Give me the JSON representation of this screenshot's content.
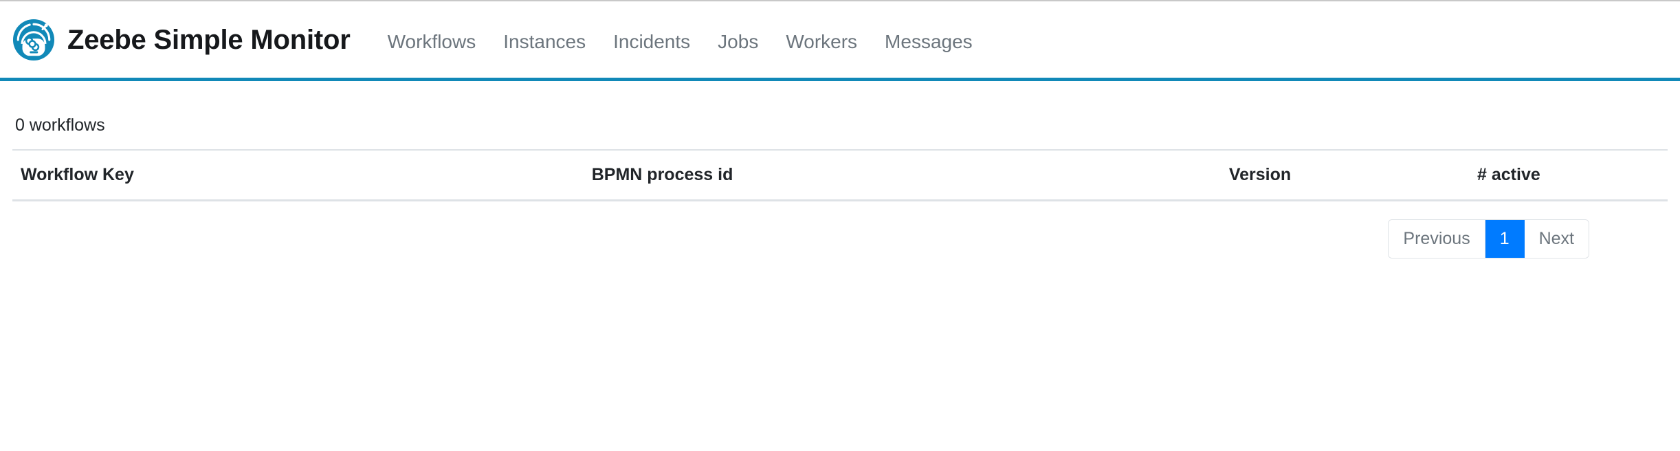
{
  "brand": {
    "title": "Zeebe Simple Monitor",
    "logo_icon": "zeebe-robot-logo",
    "accent_color": "#1189b8"
  },
  "nav": {
    "items": [
      {
        "label": "Workflows",
        "name": "workflows"
      },
      {
        "label": "Instances",
        "name": "instances"
      },
      {
        "label": "Incidents",
        "name": "incidents"
      },
      {
        "label": "Jobs",
        "name": "jobs"
      },
      {
        "label": "Workers",
        "name": "workers"
      },
      {
        "label": "Messages",
        "name": "messages"
      }
    ]
  },
  "main": {
    "count_label": "0 workflows",
    "table": {
      "columns": [
        {
          "label": "Workflow Key"
        },
        {
          "label": "BPMN process id"
        },
        {
          "label": "Version"
        },
        {
          "label": "# active"
        }
      ],
      "rows": []
    }
  },
  "pagination": {
    "previous_label": "Previous",
    "next_label": "Next",
    "pages": [
      {
        "label": "1",
        "active": true
      }
    ],
    "active_color": "#007bff"
  }
}
